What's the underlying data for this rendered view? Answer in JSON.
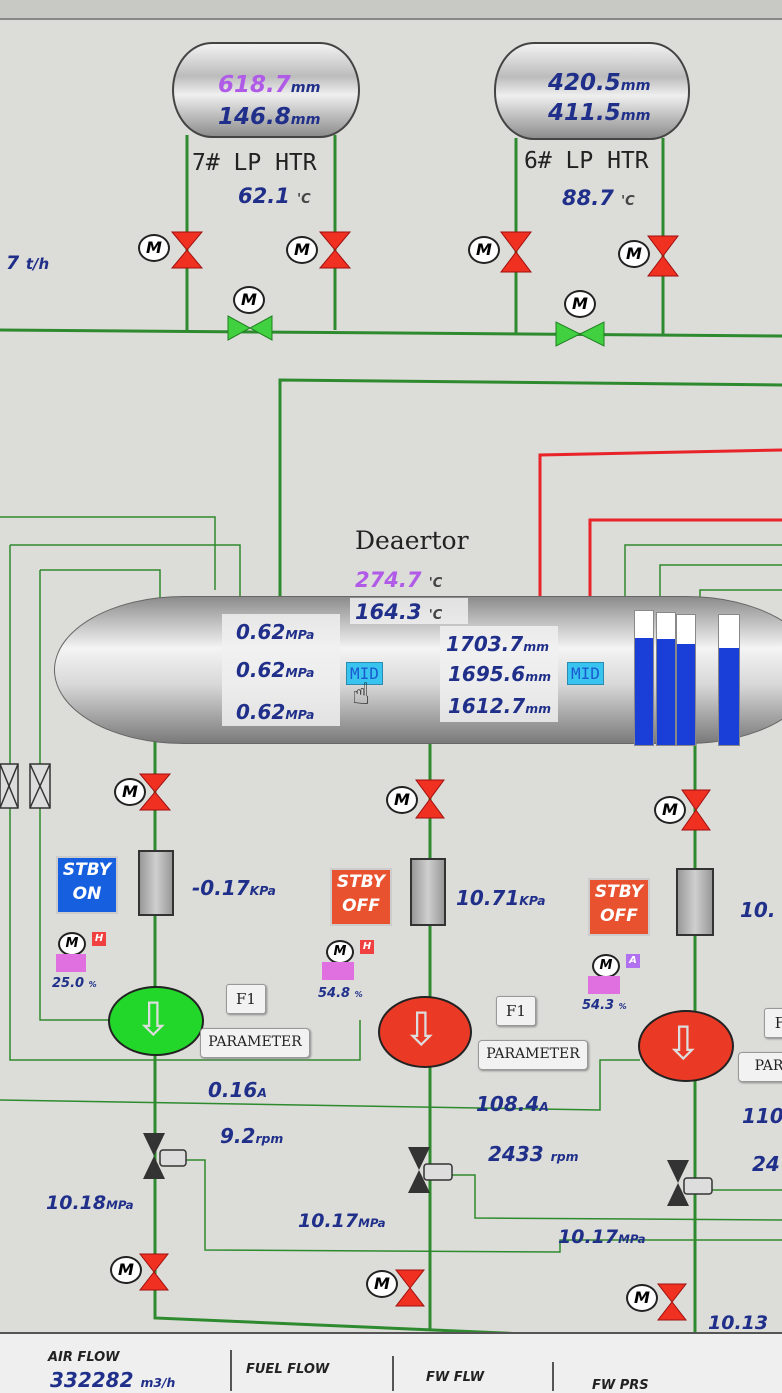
{
  "heaters": [
    {
      "name": "7# LP HTR",
      "level1": "618.7",
      "level2": "146.8",
      "temp": "62.1"
    },
    {
      "name": "6# LP HTR",
      "level1": "420.5",
      "level2": "411.5",
      "temp": "88.7"
    }
  ],
  "units": {
    "mm": "mm",
    "degc": "'C",
    "mpa": "MPa",
    "kpa": "KPa",
    "amp": "A",
    "rpm": "rpm",
    "pct": "%",
    "flow": "t/h",
    "m3h": "m3/h"
  },
  "left_flow": "7",
  "motor_label": "M",
  "deaerator": {
    "title": "Deaertor",
    "temp1": "274.7",
    "temp2": "164.3",
    "press": [
      "0.62",
      "0.62",
      "0.62"
    ],
    "levels": [
      "1703.7",
      "1695.6",
      "1612.7"
    ],
    "mid_label": "MID",
    "bar_fill": [
      0.8,
      0.8,
      0.78,
      0.75
    ]
  },
  "pumps": [
    {
      "stby": [
        "STBY",
        "ON"
      ],
      "state": "on",
      "dp": "-0.17",
      "pct": "25.0",
      "amps": "0.16",
      "rpm": "9.2",
      "out_press": "10.18",
      "f1": "F1",
      "param": "PARAMETER",
      "flag": "H"
    },
    {
      "stby": [
        "STBY",
        "OFF"
      ],
      "state": "off",
      "dp": "10.71",
      "pct": "54.8",
      "amps": "108.4",
      "rpm": "2433",
      "out_press": "10.17",
      "f1": "F1",
      "param": "PARAMETER",
      "flag": "H"
    },
    {
      "stby": [
        "STBY",
        "OFF"
      ],
      "state": "off",
      "dp": "10.",
      "pct": "54.3",
      "amps": "110",
      "rpm": "24",
      "out_press": "10.17",
      "f1": "F",
      "param": "PAR",
      "flag": "A"
    }
  ],
  "header_press": "10.13",
  "statusbar": {
    "air_flow_label": "AIR FLOW",
    "air_flow_value": "332282",
    "fuel_flow_label": "FUEL FLOW",
    "fw_flw_label": "FW FLW",
    "fw_pres_label": "FW PRS"
  },
  "colors": {
    "pipe_green": "#2e8a2e",
    "pipe_red": "#e8242a",
    "valve_red": "#f03020",
    "valve_green": "#40d040",
    "pump_on": "#22d62a",
    "pump_off": "#ea3a26",
    "value_blue": "#20308a",
    "value_purple": "#b05ae8"
  }
}
